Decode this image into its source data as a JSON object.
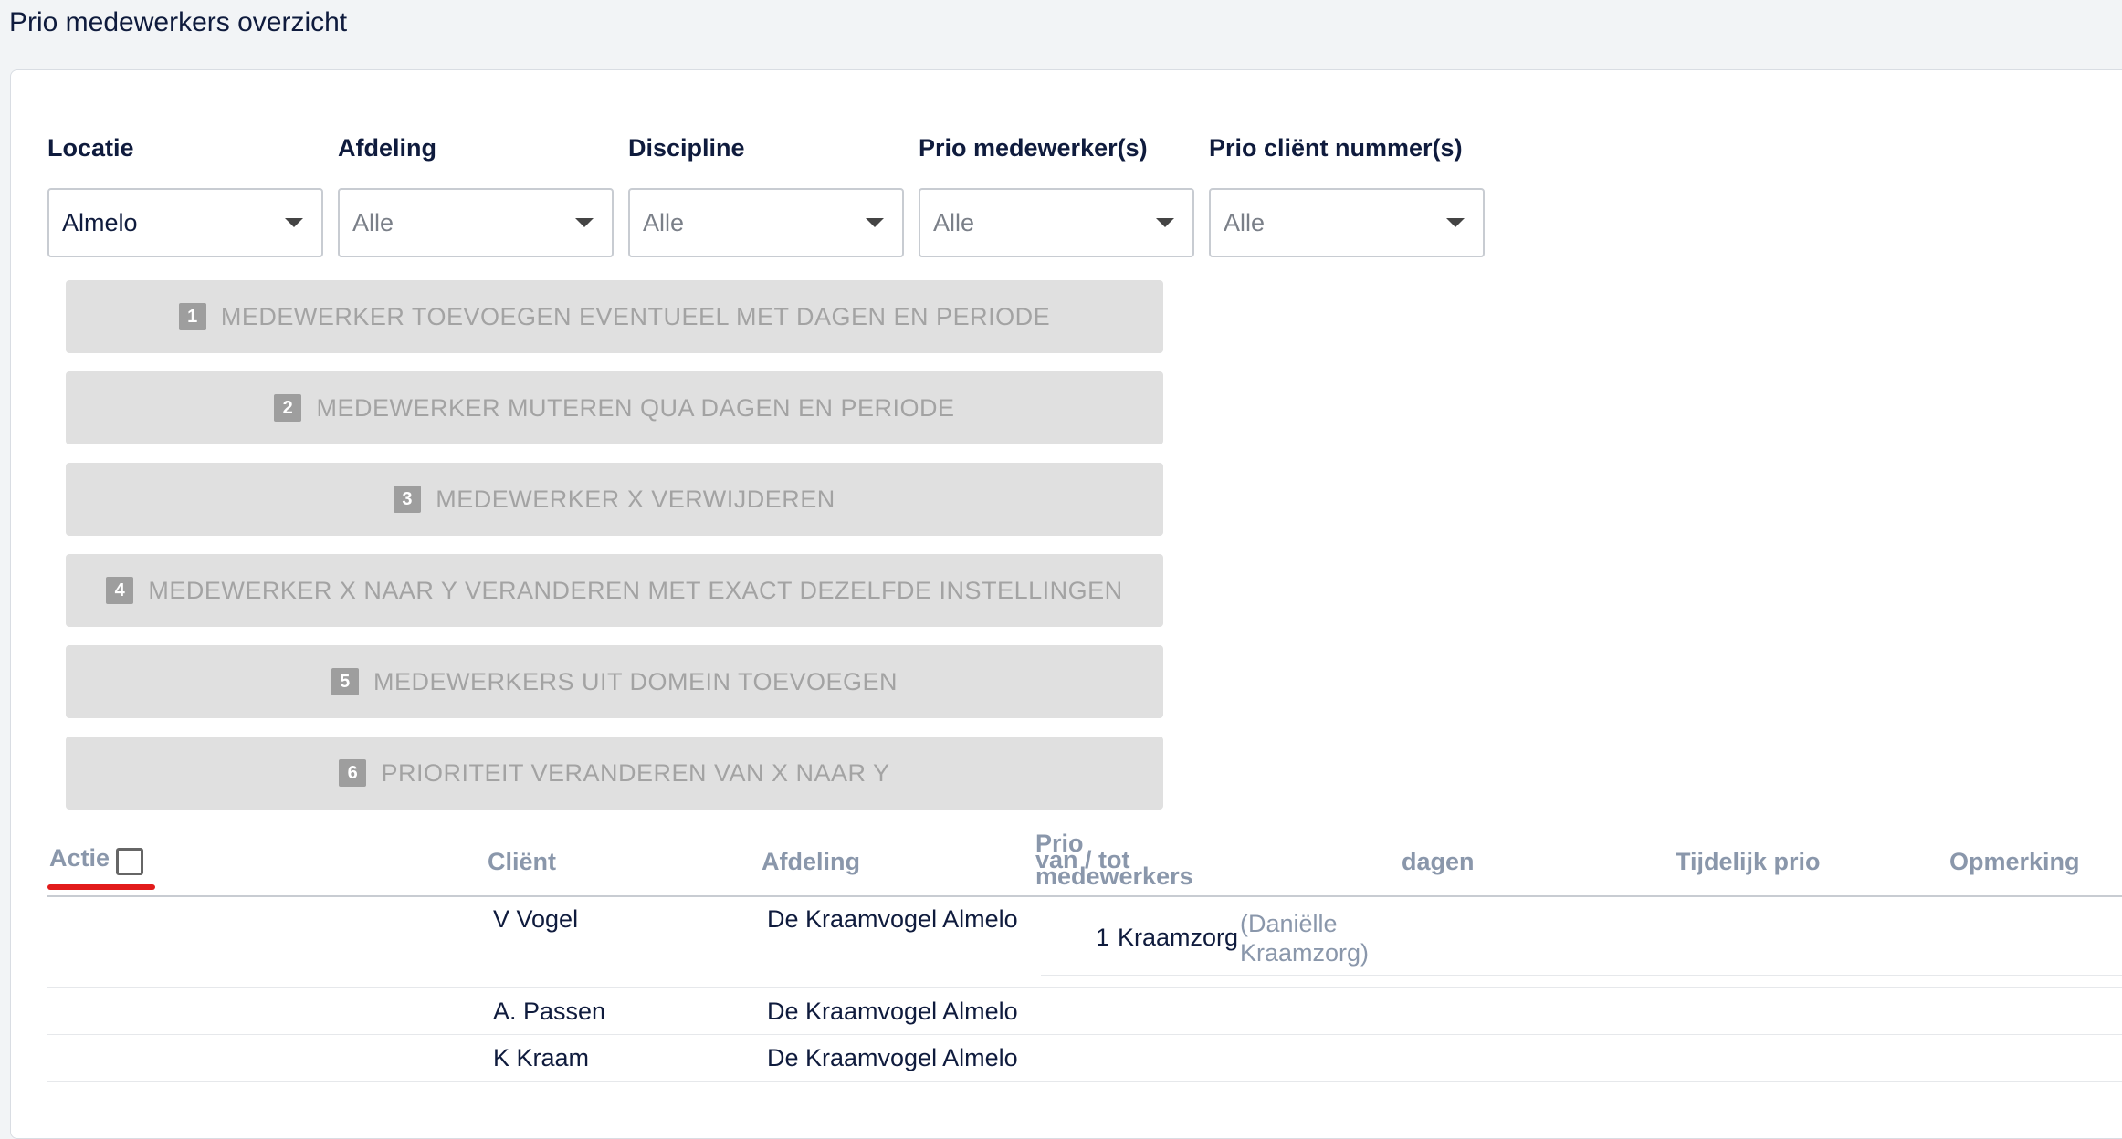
{
  "page": {
    "title": "Prio medewerkers overzicht"
  },
  "filters": [
    {
      "label": "Locatie",
      "value": "Almelo"
    },
    {
      "label": "Afdeling",
      "value": "Alle"
    },
    {
      "label": "Discipline",
      "value": "Alle"
    },
    {
      "label": "Prio medewerker(s)",
      "value": "Alle"
    },
    {
      "label": "Prio cliënt nummer(s)",
      "value": "Alle"
    }
  ],
  "actions": [
    {
      "num": "1",
      "label": "MEDEWERKER TOEVOEGEN EVENTUEEL MET DAGEN EN PERIODE"
    },
    {
      "num": "2",
      "label": "MEDEWERKER MUTEREN QUA DAGEN EN PERIODE"
    },
    {
      "num": "3",
      "label": "MEDEWERKER X VERWIJDEREN"
    },
    {
      "num": "4",
      "label": "MEDEWERKER X NAAR Y VERANDEREN MET EXACT DEZELFDE INSTELLINGEN"
    },
    {
      "num": "5",
      "label": "MEDEWERKERS UIT DOMEIN TOEVOEGEN"
    },
    {
      "num": "6",
      "label": "PRIORITEIT VERANDEREN VAN X NAAR Y"
    }
  ],
  "table": {
    "headers": {
      "actie": "Actie",
      "client": "Cliënt",
      "afdeling": "Afdeling",
      "prio_line1": "Prio",
      "prio_line2": "van / tot",
      "prio_line3": "medewerkers",
      "dagen": "dagen",
      "tijdelijk": "Tijdelijk prio",
      "opmerking": "Opmerking"
    },
    "rows": [
      {
        "client": "V Vogel",
        "afdeling": "De Kraamvogel Almelo",
        "prio": {
          "num": "1",
          "name": "Kraamzorg",
          "note": "(Daniëlle Kraamzorg)"
        }
      },
      {
        "client": "A. Passen",
        "afdeling": "De Kraamvogel Almelo"
      },
      {
        "client": "K Kraam",
        "afdeling": "De Kraamvogel Almelo"
      }
    ]
  },
  "colors": {
    "accent_underline": "#e21b1b",
    "header_text": "#8a97ab",
    "title_text": "#0f1b3d"
  }
}
